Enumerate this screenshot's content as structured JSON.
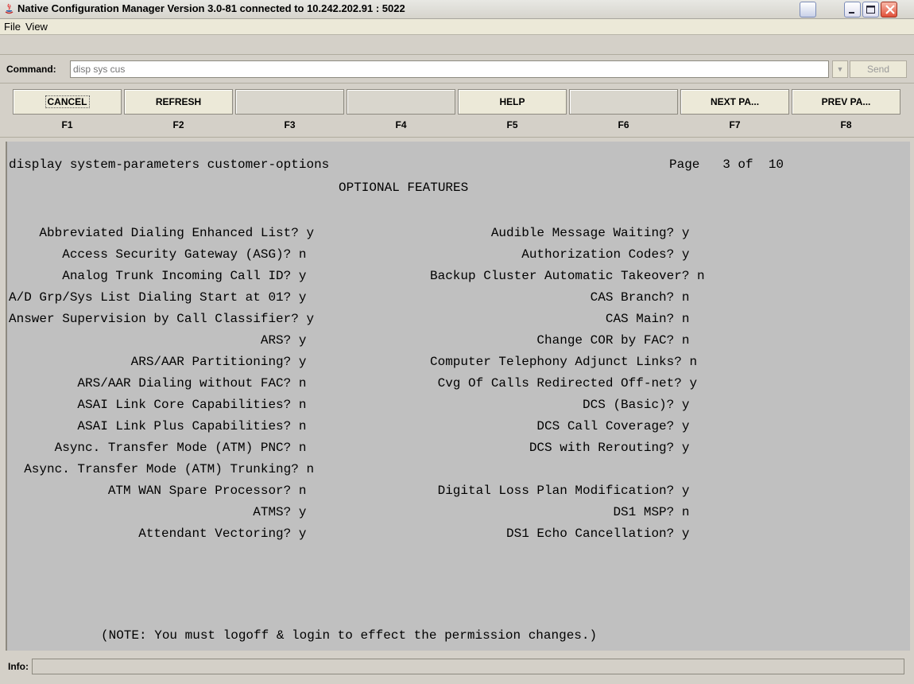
{
  "window": {
    "title": "Native Configuration Manager Version 3.0-81 connected to 10.242.202.91 : 5022"
  },
  "menu": [
    "File",
    "View"
  ],
  "command": {
    "label": "Command:",
    "placeholder": "disp sys cus",
    "send_label": "Send"
  },
  "fkeys": [
    {
      "label": "CANCEL",
      "key": "F1"
    },
    {
      "label": "REFRESH",
      "key": "F2"
    },
    {
      "label": "",
      "key": "F3"
    },
    {
      "label": "",
      "key": "F4"
    },
    {
      "label": "HELP",
      "key": "F5"
    },
    {
      "label": "",
      "key": "F6"
    },
    {
      "label": "NEXT PA...",
      "key": "F7"
    },
    {
      "label": "PREV PA...",
      "key": "F8"
    }
  ],
  "screen": {
    "command_line": "display system-parameters customer-options",
    "page_indicator": "Page   3 of  10",
    "heading": "OPTIONAL FEATURES",
    "left_features": [
      "    Abbreviated Dialing Enhanced List? y",
      "       Access Security Gateway (ASG)? n",
      "       Analog Trunk Incoming Call ID? y",
      "A/D Grp/Sys List Dialing Start at 01? y",
      "Answer Supervision by Call Classifier? y",
      "                                 ARS? y",
      "                ARS/AAR Partitioning? y",
      "         ARS/AAR Dialing without FAC? n",
      "         ASAI Link Core Capabilities? n",
      "         ASAI Link Plus Capabilities? n",
      "      Async. Transfer Mode (ATM) PNC? n",
      "  Async. Transfer Mode (ATM) Trunking? n",
      "             ATM WAN Spare Processor? n",
      "                                ATMS? y",
      "                 Attendant Vectoring? y"
    ],
    "right_features": [
      "        Audible Message Waiting? y",
      "            Authorization Codes? y",
      "Backup Cluster Automatic Takeover? n",
      "                     CAS Branch? n",
      "                       CAS Main? n",
      "              Change COR by FAC? n",
      "Computer Telephony Adjunct Links? n",
      " Cvg Of Calls Redirected Off-net? y",
      "                    DCS (Basic)? y",
      "              DCS Call Coverage? y",
      "             DCS with Rerouting? y",
      "",
      " Digital Loss Plan Modification? y",
      "                        DS1 MSP? n",
      "          DS1 Echo Cancellation? y"
    ],
    "note": "(NOTE: You must logoff & login to effect the permission changes.)"
  },
  "info": {
    "label": "Info:",
    "value": ""
  }
}
